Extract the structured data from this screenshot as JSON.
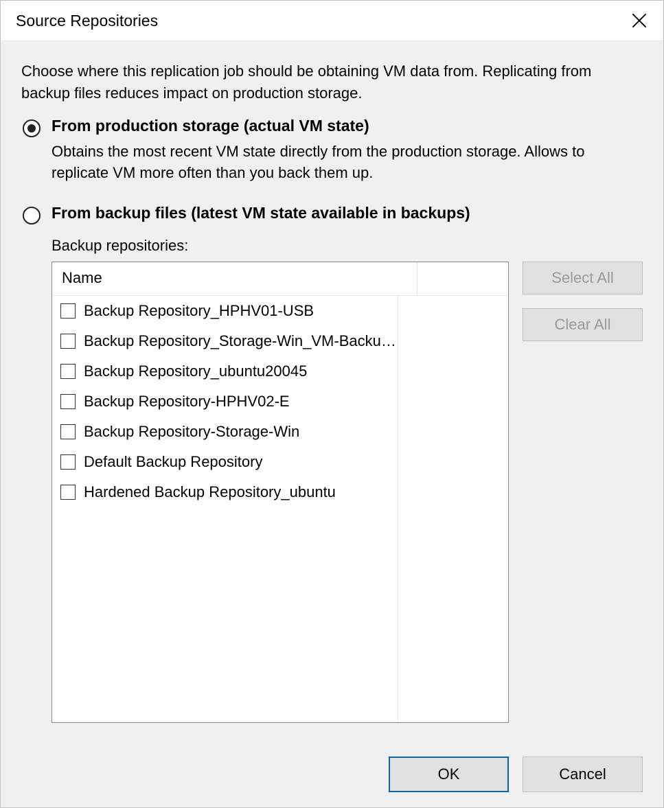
{
  "window": {
    "title": "Source Repositories"
  },
  "intro": "Choose where this replication job should be obtaining VM data from. Replicating from backup files reduces impact on production storage.",
  "options": {
    "production": {
      "label": "From production storage (actual VM state)",
      "desc": "Obtains the most recent VM state directly from the production storage. Allows to replicate VM more often than you back them up.",
      "selected": true
    },
    "backup": {
      "label": "From backup files (latest VM state available in backups)",
      "selected": false
    }
  },
  "repos": {
    "label": "Backup repositories:",
    "column_name": "Name",
    "items": [
      {
        "name": "Backup Repository_HPHV01-USB"
      },
      {
        "name": "Backup Repository_Storage-Win_VM-Backup-Win"
      },
      {
        "name": "Backup Repository_ubuntu20045"
      },
      {
        "name": "Backup Repository-HPHV02-E"
      },
      {
        "name": "Backup Repository-Storage-Win"
      },
      {
        "name": "Default Backup Repository"
      },
      {
        "name": "Hardened Backup Repository_ubuntu"
      }
    ]
  },
  "buttons": {
    "select_all": "Select All",
    "clear_all": "Clear All",
    "ok": "OK",
    "cancel": "Cancel"
  }
}
